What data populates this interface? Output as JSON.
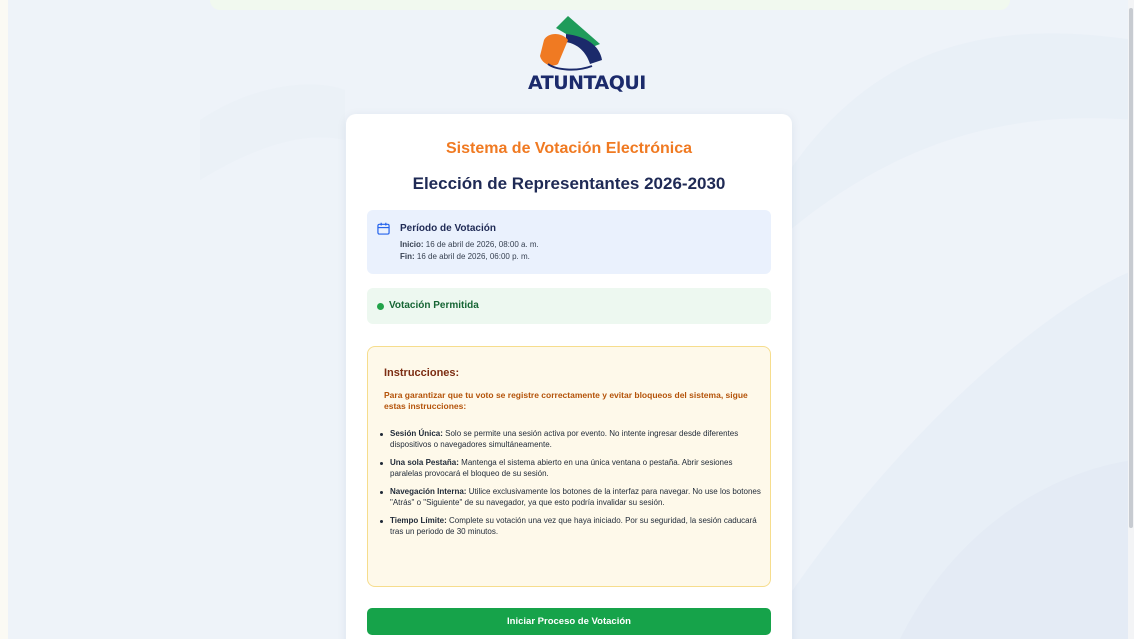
{
  "colors": {
    "accent_orange": "#f07a22",
    "navy": "#1f2a55",
    "success_green": "#16a34a",
    "warning_bg": "#fef9ea"
  },
  "logo": {
    "name": "ATUNTAQUI",
    "icon": "atuntaqui-logo-icon"
  },
  "card": {
    "system_title": "Sistema de Votación Electrónica",
    "election_title": "Elección de Representantes 2026-2030"
  },
  "period": {
    "icon": "calendar-icon",
    "heading": "Período de Votación",
    "start_label": "Inicio:",
    "start_value": "16 de abril de 2026, 08:00 a. m.",
    "end_label": "Fin:",
    "end_value": "16 de abril de 2026, 06:00 p. m."
  },
  "status": {
    "text": "Votación Permitida"
  },
  "instructions": {
    "title": "Instrucciones:",
    "intro": "Para garantizar que tu voto se registre correctamente y evitar bloqueos del sistema, sigue estas instrucciones:",
    "items": [
      {
        "label": "Sesión Única:",
        "text": "Solo se permite una sesión activa por evento. No intente ingresar desde diferentes dispositivos o navegadores simultáneamente."
      },
      {
        "label": "Una sola Pestaña:",
        "text": "Mantenga el sistema abierto en una única ventana o pestaña. Abrir sesiones paralelas provocará el bloqueo de su sesión."
      },
      {
        "label": "Navegación Interna:",
        "text": "Utilice exclusivamente los botones de la interfaz para navegar. No use los botones \"Atrás\" o \"Siguiente\" de su navegador, ya que esto podría invalidar su sesión."
      },
      {
        "label": "Tiempo Límite:",
        "text": "Complete su votación una vez que haya iniciado. Por su seguridad, la sesión caducará tras un periodo de 30 minutos."
      }
    ]
  },
  "actions": {
    "start_button": "Iniciar Proceso de Votación"
  }
}
